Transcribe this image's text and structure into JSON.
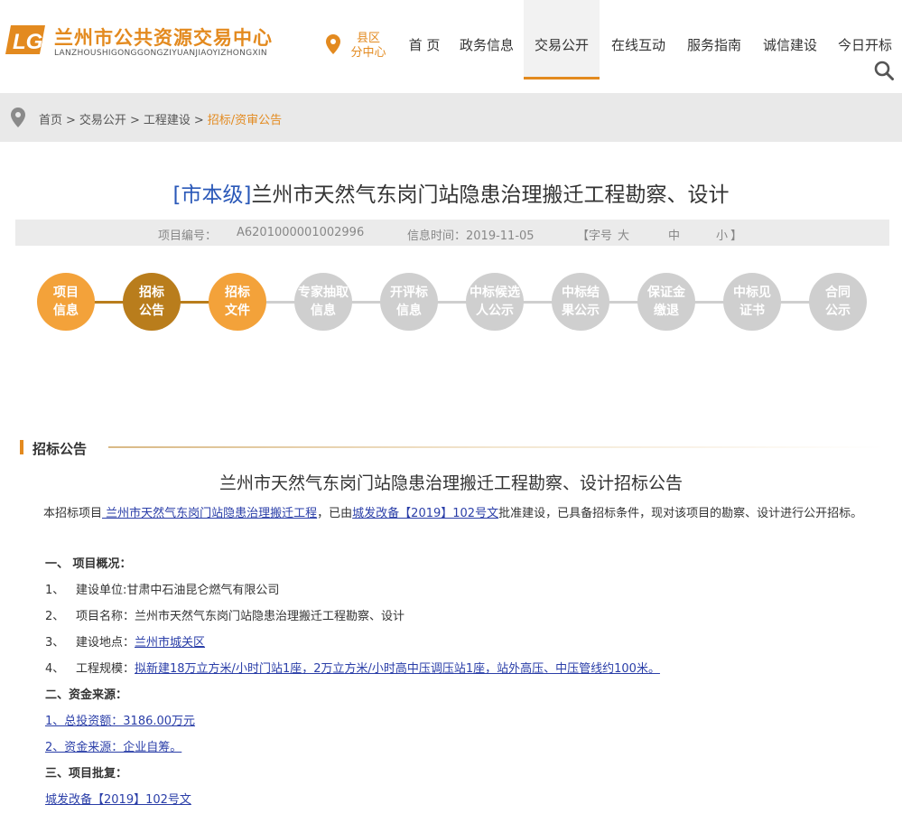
{
  "header": {
    "brand_cn": "兰州市公共资源交易中心",
    "brand_en": "LANZHOUSHIGONGGONGZIYUANJIAOYIZHONGXIN",
    "location_line1": "县区",
    "location_line2": "分中心",
    "accent_color": "#e38a1f",
    "nav": [
      "首 页",
      "政务信息",
      "交易公开",
      "在线互动",
      "服务指南",
      "诚信建设",
      "今日开标"
    ],
    "active_nav": "交易公开"
  },
  "breadcrumb": {
    "items": [
      "首页",
      "交易公开",
      "工程建设"
    ],
    "separator": ">",
    "current": "招标/资审公告"
  },
  "title": {
    "tag": "[市本级]",
    "text": "兰州市天然气东岗门站隐患治理搬迁工程勘察、设计"
  },
  "meta": {
    "project_no_label": "项目编号：",
    "project_no": "A6201000001002996",
    "time_text": "信息时间：2019-11-05",
    "font_label": "【字号",
    "font_large": "大",
    "font_medium": "中",
    "font_small": "小",
    "font_close": "】"
  },
  "steps": [
    {
      "line1": "项目",
      "line2": "信息",
      "state": "orange"
    },
    {
      "line1": "招标",
      "line2": "公告",
      "state": "brown"
    },
    {
      "line1": "招标",
      "line2": "文件",
      "state": "orange"
    },
    {
      "line1": "专家抽取",
      "line2": "信息",
      "state": "grey"
    },
    {
      "line1": "开评标",
      "line2": "信息",
      "state": "grey"
    },
    {
      "line1": "中标候选",
      "line2": "人公示",
      "state": "grey"
    },
    {
      "line1": "中标结",
      "line2": "果公示",
      "state": "grey"
    },
    {
      "line1": "保证金",
      "line2": "缴退",
      "state": "grey"
    },
    {
      "line1": "中标见",
      "line2": "证书",
      "state": "grey"
    },
    {
      "line1": "合同",
      "line2": "公示",
      "state": "grey"
    }
  ],
  "section": {
    "heading": "招标公告",
    "announcement_title": "兰州市天然气东岗门站隐患治理搬迁工程勘察、设计招标公告",
    "intro_prefix": "本招标项目",
    "intro_link1": " 兰州市天然气东岗门站隐患治理搬迁工程",
    "intro_mid": "，已由",
    "intro_link2": "城发改备【2019】102号文",
    "intro_suffix": "批准建设，已具备招标条件，现对该项目的勘察、设计进行公开招标。",
    "h1": "一、  项目概况：",
    "items": [
      {
        "num": "1、",
        "label": "建设单位:",
        "value": "甘肃中石油昆仑燃气有限公司",
        "link": false
      },
      {
        "num": "2、",
        "label": "项目名称：",
        "value": "兰州市天然气东岗门站隐患治理搬迁工程勘察、设计",
        "link": false
      },
      {
        "num": "3、",
        "label": "建设地点：",
        "value": "兰州市城关区  ",
        "link": true
      },
      {
        "num": "4、",
        "label": "工程规模：",
        "value": "拟新建18万立方米/小时门站1座，2万立方米/小时高中压调压站1座，站外高压、中压管线约100米。",
        "link": true
      }
    ],
    "h2": "二、资金来源：",
    "fund1": "1、总投资额：3186.00万元",
    "fund2": "2、资金来源：企业自筹。",
    "h3": "三、项目批复：",
    "approval": "城发改备【2019】102号文"
  }
}
